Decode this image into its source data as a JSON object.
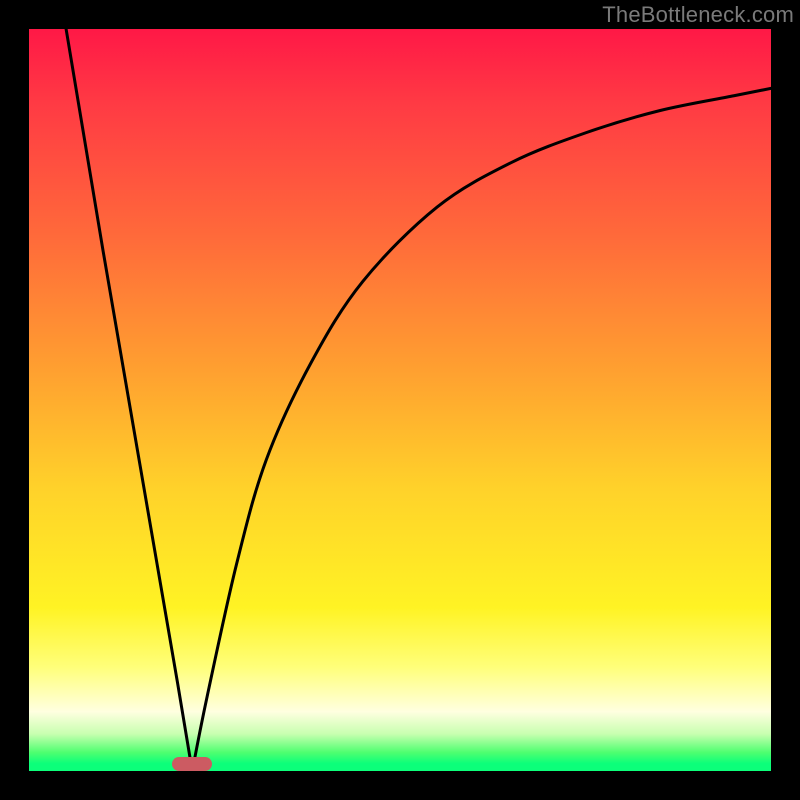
{
  "watermark": "TheBottleneck.com",
  "chart_data": {
    "type": "line",
    "title": "",
    "xlabel": "",
    "ylabel": "",
    "xlim": [
      0,
      100
    ],
    "ylim": [
      0,
      100
    ],
    "grid": false,
    "legend": false,
    "background_gradient": {
      "stops": [
        {
          "pos": 0,
          "color": "#ff1846"
        },
        {
          "pos": 10,
          "color": "#ff3a44"
        },
        {
          "pos": 28,
          "color": "#ff6a3a"
        },
        {
          "pos": 46,
          "color": "#ffa030"
        },
        {
          "pos": 62,
          "color": "#ffd22a"
        },
        {
          "pos": 78,
          "color": "#fff324"
        },
        {
          "pos": 86,
          "color": "#ffff7a"
        },
        {
          "pos": 92,
          "color": "#ffffe0"
        },
        {
          "pos": 95,
          "color": "#c8ffb0"
        },
        {
          "pos": 97.5,
          "color": "#4eff70"
        },
        {
          "pos": 100,
          "color": "#0cff7a"
        }
      ]
    },
    "minimum_marker": {
      "x": 22,
      "y": 0,
      "color": "#cc5b62"
    },
    "series": [
      {
        "name": "bottleneck-curve",
        "x": [
          5,
          10,
          15,
          20,
          22,
          24,
          28,
          32,
          38,
          45,
          55,
          65,
          75,
          85,
          95,
          100
        ],
        "y": [
          100,
          70,
          41,
          12,
          0,
          10,
          28,
          42,
          55,
          66,
          76,
          82,
          86,
          89,
          91,
          92
        ]
      }
    ]
  }
}
